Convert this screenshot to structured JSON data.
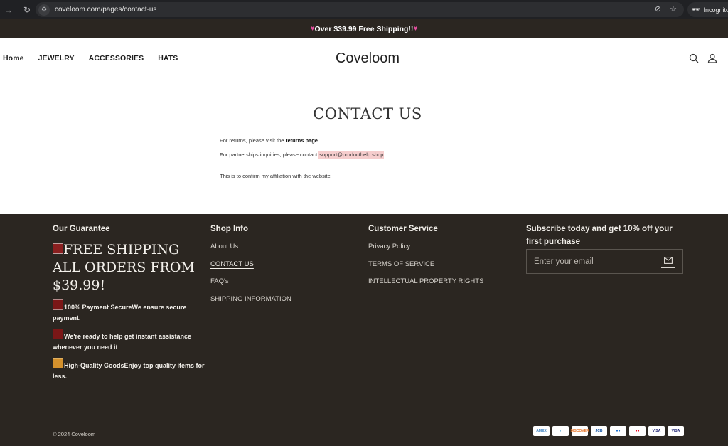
{
  "browser": {
    "url": "coveloom.com/pages/contact-us",
    "incognito_label": "Incognito"
  },
  "announcement": {
    "text": "Over $39.99 Free Shipping!!",
    "heart": "♥"
  },
  "header": {
    "nav": [
      {
        "label": "Home"
      },
      {
        "label": "JEWELRY"
      },
      {
        "label": "ACCESSORIES"
      },
      {
        "label": "HATS"
      }
    ],
    "logo": "Coveloom"
  },
  "content": {
    "title": "CONTACT US",
    "returns_prefix": "For returns, please visit the ",
    "returns_link": "returns page",
    "returns_suffix": ".",
    "partners_prefix": "For partnerships inquiries, please contact ",
    "partners_email": "support@producthelp.shop",
    "partners_suffix": ".",
    "affiliation": "This is to confirm my affiliation with the website"
  },
  "footer": {
    "guarantee": {
      "heading": "Our Guarantee",
      "big_text": "FREE SHIPPING ALL ORDERS FROM $39.99!",
      "items": [
        {
          "text": "100% Payment SecureWe ensure secure payment."
        },
        {
          "text": "We're ready to help get instant assistance whenever you need it"
        },
        {
          "text": "High-Quality GoodsEnjoy top quality items for less."
        }
      ]
    },
    "shop_info": {
      "heading": "Shop Info",
      "links": [
        {
          "label": "About Us"
        },
        {
          "label": "CONTACT US"
        },
        {
          "label": "FAQ's"
        },
        {
          "label": "SHIPPING INFORMATION"
        }
      ]
    },
    "customer_service": {
      "heading": "Customer Service",
      "links": [
        {
          "label": "Privacy Policy"
        },
        {
          "label": "TERMS OF SERVICE"
        },
        {
          "label": "INTELLECTUAL PROPERTY RIGHTS"
        }
      ]
    },
    "newsletter": {
      "heading": "Subscribe today and get 10% off your first purchase",
      "placeholder": "Enter your email",
      "value": ""
    },
    "copyright": "© 2024 Coveloom",
    "payments": [
      {
        "name": "American Express",
        "label": "AMEX",
        "color": "#2e77bc"
      },
      {
        "name": "Diners Club",
        "label": "◐",
        "color": "#0079be"
      },
      {
        "name": "Discover",
        "label": "DISCOVER",
        "color": "#e8762b"
      },
      {
        "name": "JCB",
        "label": "JCB",
        "color": "#0b4ea2"
      },
      {
        "name": "Maestro",
        "label": "●●",
        "color": "#1a6fd0"
      },
      {
        "name": "Mastercard",
        "label": "●●",
        "color": "#eb001b"
      },
      {
        "name": "Visa",
        "label": "VISA",
        "color": "#1a1f71"
      },
      {
        "name": "Visa Electron",
        "label": "VISA",
        "color": "#1a1f71"
      }
    ]
  }
}
